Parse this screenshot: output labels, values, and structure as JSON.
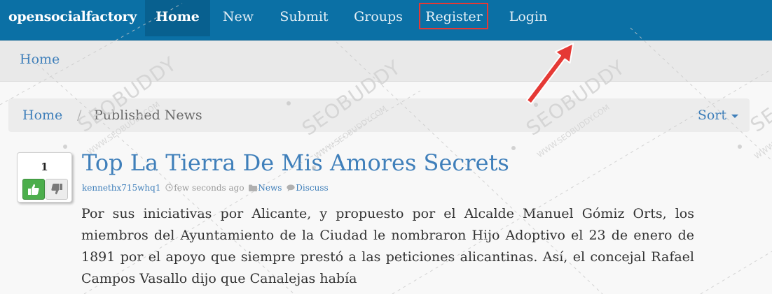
{
  "navbar": {
    "brand": "opensocialfactory",
    "items": [
      {
        "label": "Home",
        "active": true
      },
      {
        "label": "New"
      },
      {
        "label": "Submit"
      },
      {
        "label": "Groups"
      },
      {
        "label": "Register",
        "highlighted": true
      },
      {
        "label": "Login"
      }
    ]
  },
  "subbar": {
    "home_label": "Home"
  },
  "breadcrumb": {
    "home": "Home",
    "separator": "/",
    "current": "Published News",
    "sort_label": "Sort"
  },
  "post": {
    "votes": "1",
    "title": "Top La Tierra De Mis Amores Secrets",
    "author": "kennethx715whq1",
    "time": "few seconds ago",
    "category": "News",
    "discuss": "Discuss",
    "body": "Por sus iniciativas por Alicante, y propuesto por el Alcalde Manuel Gómiz Orts, los miembros del Ayuntamiento de la Ciudad le nombraron Hijo Adoptivo el 23 de enero de 1891 por el apoyo que siempre prestó a las peticiones alicantinas. Así, el concejal Rafael Campos Vasallo dijo que Canalejas había"
  },
  "watermark": {
    "text": "SEOBUDDY",
    "subtext": "WWW.SEOBUDDY.COM"
  },
  "colors": {
    "navbar": "#0b70a5",
    "link": "#3f7fba",
    "highlight": "#e53935",
    "upvote": "#4cae4c"
  },
  "icons": [
    "thumbs-up-icon",
    "thumbs-down-icon",
    "clock-icon",
    "folder-icon",
    "comment-icon",
    "caret-down-icon",
    "arrow-annotation-icon"
  ]
}
